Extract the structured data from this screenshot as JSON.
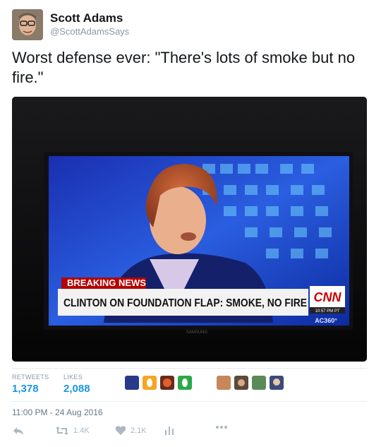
{
  "user": {
    "display_name": "Scott Adams",
    "handle": "@ScottAdamsSays"
  },
  "tweet": {
    "text": "Worst defense ever: \"There's lots of smoke but no fire.\""
  },
  "photo": {
    "icon": "tv-screenshot",
    "banner_label": "BREAKING NEWS",
    "headline": "CLINTON ON FOUNDATION FLAP: SMOKE, NO FIRE",
    "network": "CNN",
    "time": "10:57 PM PT",
    "show": "AC360°",
    "tv_brand": "SAMSUNG"
  },
  "stats": {
    "retweets_label": "RETWEETS",
    "retweets_value": "1,378",
    "likes_label": "LIKES",
    "likes_value": "2,088"
  },
  "timestamp": "11:00 PM - 24 Aug 2016",
  "actions": {
    "reply_icon": "reply-icon",
    "retweet_icon": "retweet-icon",
    "retweet_count": "1.4K",
    "like_icon": "heart-icon",
    "like_count": "2.1K",
    "analytics_icon": "analytics-icon",
    "more_icon": "more-icon"
  },
  "colors": {
    "link_blue": "#1b95e0",
    "muted": "#8899a6",
    "cnn_red": "#cc0000"
  }
}
